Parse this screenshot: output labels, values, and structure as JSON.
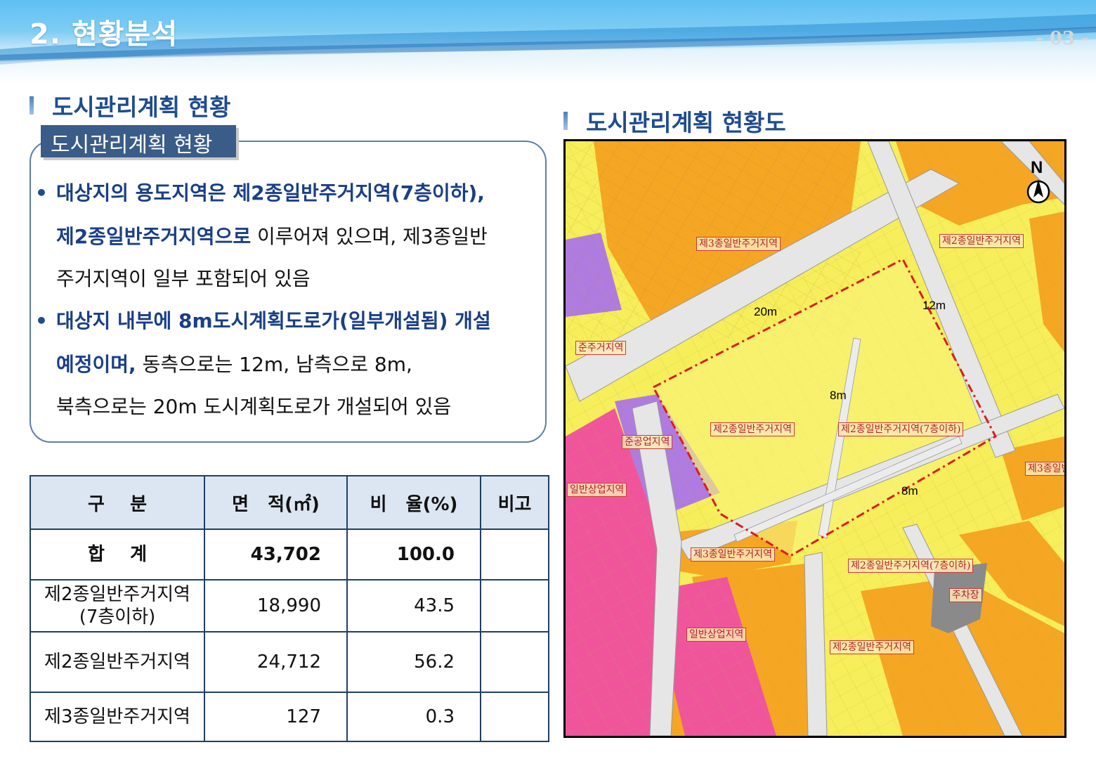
{
  "header": {
    "title": "2. 현황분석",
    "page_number": "- 03 -"
  },
  "left_section": {
    "heading": "도시관리계획 현황",
    "box_tab": "도시관리계획 현황",
    "bullets": [
      {
        "lines": [
          [
            {
              "text": "대상지의 용도지역은 제2종일반주거지역(7층이하),",
              "emph": true
            }
          ],
          [
            {
              "text": "제2종일반주거지역으로",
              "emph": true
            },
            {
              "text": " 이루어져 있으며, 제3종일반",
              "emph": false
            }
          ],
          [
            {
              "text": "주거지역이 일부 포함되어 있음",
              "emph": false
            }
          ]
        ]
      },
      {
        "lines": [
          [
            {
              "text": "대상지 내부에 8m도시계획도로가(일부개설됨) 개설",
              "emph": true
            }
          ],
          [
            {
              "text": "예정이며,",
              "emph": true
            },
            {
              "text": " 동측으로는 12m, 남측으로 8m,",
              "emph": false
            }
          ],
          [
            {
              "text": "북측으로는 20m 도시계획도로가 개설되어 있음",
              "emph": false
            }
          ]
        ]
      }
    ]
  },
  "table": {
    "headers": [
      "구    분",
      "면   적(㎡)",
      "비   율(%)",
      "비고"
    ],
    "rows": [
      {
        "category": "합    계",
        "area": "43,702",
        "ratio": "100.0",
        "note": ""
      },
      {
        "category": "제2종일반주거지역\n(7층이하)",
        "area": "18,990",
        "ratio": "43.5",
        "note": ""
      },
      {
        "category": "제2종일반주거지역",
        "area": "24,712",
        "ratio": "56.2",
        "note": ""
      },
      {
        "category": "제3종일반주거지역",
        "area": "127",
        "ratio": "0.3",
        "note": ""
      }
    ]
  },
  "right_section": {
    "heading": "도시관리계획 현황도"
  },
  "map": {
    "north": "N",
    "road_labels": [
      "20m",
      "12m",
      "8m",
      "8m"
    ],
    "zone_labels": [
      "제3종일반주거지역",
      "제2종일반주거지역",
      "준주거지역",
      "준공업지역",
      "일반상업지역",
      "제2종일반주거지역",
      "제2종일반주거지역(7층이하)",
      "제3종일반",
      "제3종일반주거지역",
      "제2종일반주거지역(7층이하)",
      "주차장",
      "일반상업지역",
      "제2종일반주거지역"
    ],
    "colors": {
      "residential_2": "#f6ee5a",
      "residential_3": "#f5a623",
      "commercial": "#f0559c",
      "quasi_industrial": "#b07be0",
      "site_boundary": "#d81e1e",
      "road": "#e6e6e6",
      "parking": "#8a8a8a"
    }
  },
  "colors": {
    "heading_blue": "#1f4c8f",
    "tab_bg": "#3a5c88",
    "table_header_bg": "#dce6f3"
  }
}
